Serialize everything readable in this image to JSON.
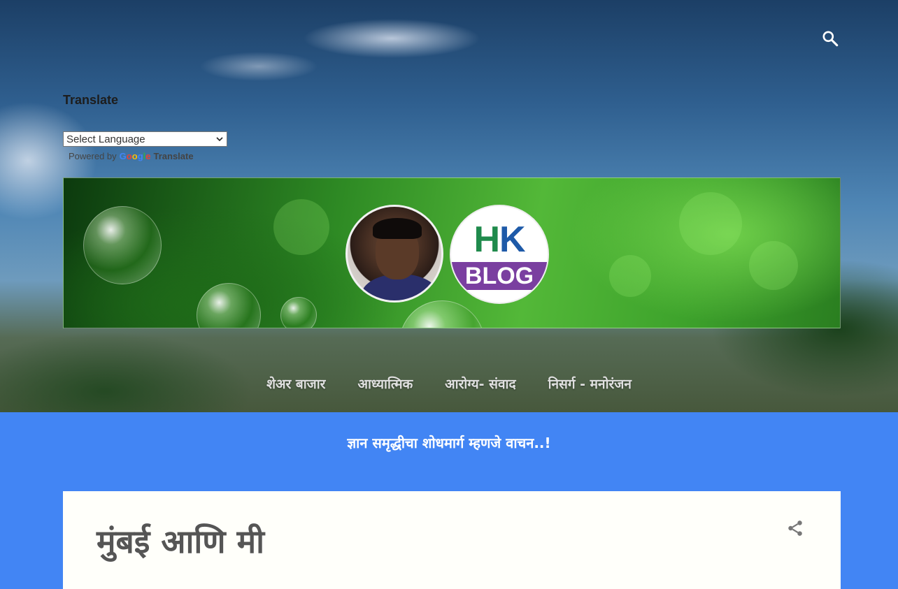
{
  "header": {
    "search_icon": "search-icon"
  },
  "translate": {
    "title": "Translate",
    "select_label": "Select Language",
    "powered_by": "Powered by",
    "google": "Google",
    "translate_word": "Translate"
  },
  "banner": {
    "logo_letters_h": "H",
    "logo_letters_k": "K",
    "logo_band": "BLOG"
  },
  "nav": {
    "items": [
      {
        "label": "शेअर बाजार"
      },
      {
        "label": "आध्यात्मिक"
      },
      {
        "label": "आरोग्य- संवाद"
      },
      {
        "label": "निसर्ग - मनोरंजन"
      }
    ]
  },
  "tagline": "ज्ञान समृद्धीचा शोधमार्ग म्हणजे वाचन..!",
  "post": {
    "title": "मुंबई आणि मी",
    "share_icon": "share-icon"
  },
  "colors": {
    "accent_blue": "#4285f4",
    "card_bg": "#fffffa",
    "title_gray": "#555555",
    "logo_green": "#1f8a4c",
    "logo_blue": "#1e5aa8",
    "logo_purple": "#7a3fa0"
  }
}
